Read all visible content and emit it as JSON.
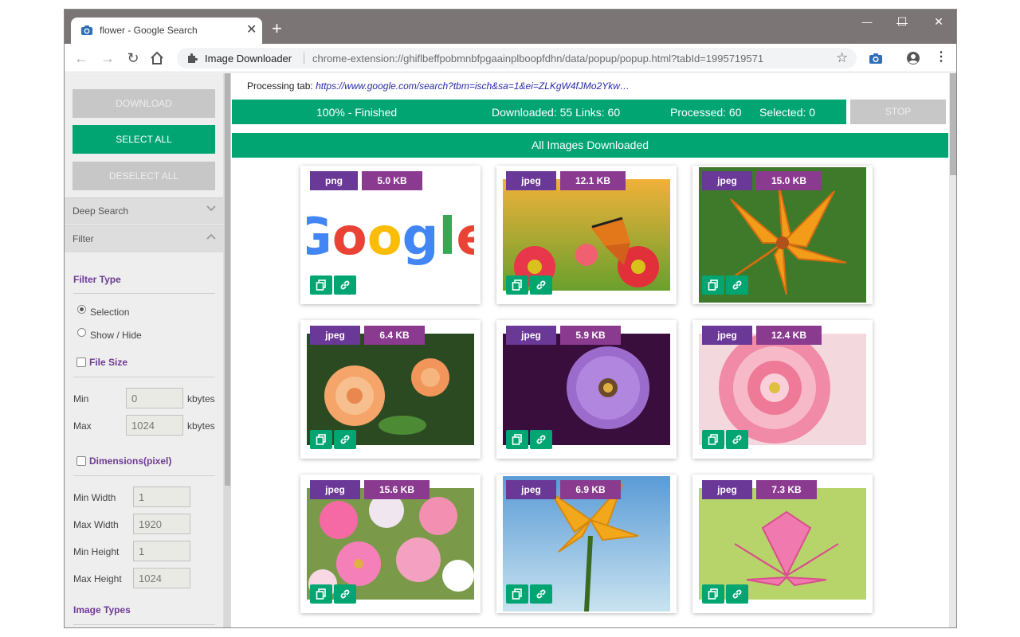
{
  "browser": {
    "tab_title": "flower - Google Search",
    "new_tab": "+",
    "close_glyph": "✕",
    "extension_name": "Image Downloader",
    "url": "chrome-extension://ghiflbeffpobmnbfpgaainplboopfdhn/data/popup/popup.html?tabId=1995719571",
    "win_min": "—",
    "win_max": "☐",
    "win_close": "✕"
  },
  "sidebar": {
    "download_label": "DOWNLOAD",
    "select_all_label": "SELECT ALL",
    "deselect_all_label": "DESELECT ALL",
    "deep_search_label": "Deep Search",
    "filter_label": "Filter",
    "filter_type_title": "Filter Type",
    "radio_selection": "Selection",
    "radio_showhide": "Show / Hide",
    "file_size_title": "File Size",
    "min_label": "Min",
    "max_label": "Max",
    "min_kb": "0",
    "max_kb": "1024",
    "unit": "kbytes",
    "dimensions_title": "Dimensions(pixel)",
    "min_width_label": "Min Width",
    "max_width_label": "Max Width",
    "min_height_label": "Min Height",
    "max_height_label": "Max Height",
    "min_width": "1",
    "max_width": "1920",
    "min_height": "1",
    "max_height": "1024",
    "image_types_title": "Image Types"
  },
  "main": {
    "processing_label": "Processing tab:",
    "processing_url": "https://www.google.com/search?tbm=isch&sa=1&ei=ZLKgW4fJMo2Ykw…",
    "progress_text": "100% - Finished",
    "downloaded_text": "Downloaded: 55  Links: 60",
    "processed_text": "Processed: 60",
    "selected_text": "Selected: 0",
    "progress_fraction": 1.0,
    "stop_label": "STOP",
    "banner": "All Images Downloaded"
  },
  "images": [
    {
      "type": "png",
      "size": "5.0 KB",
      "subject": "google-logo"
    },
    {
      "type": "jpeg",
      "size": "12.1 KB",
      "subject": "butterfly-flowers"
    },
    {
      "type": "jpeg",
      "size": "15.0 KB",
      "subject": "orange-lily"
    },
    {
      "type": "jpeg",
      "size": "6.4 KB",
      "subject": "orange-roses"
    },
    {
      "type": "jpeg",
      "size": "5.9 KB",
      "subject": "purple-daisy"
    },
    {
      "type": "jpeg",
      "size": "12.4 KB",
      "subject": "pink-dahlia"
    },
    {
      "type": "jpeg",
      "size": "15.6 KB",
      "subject": "flower-bouquet"
    },
    {
      "type": "jpeg",
      "size": "6.9 KB",
      "subject": "yellow-flower-sky"
    },
    {
      "type": "jpeg",
      "size": "7.3 KB",
      "subject": "pink-lotus"
    }
  ],
  "colors": {
    "accent_green": "#00a572",
    "tag_purple": "#6a3896",
    "size_purple": "#8a3b8f",
    "section_purple": "#6d3a94"
  },
  "icons": {
    "copy": "copy-icon",
    "link": "link-icon",
    "star": "star-icon",
    "account": "account-icon",
    "menu": "menu-dots-icon"
  }
}
